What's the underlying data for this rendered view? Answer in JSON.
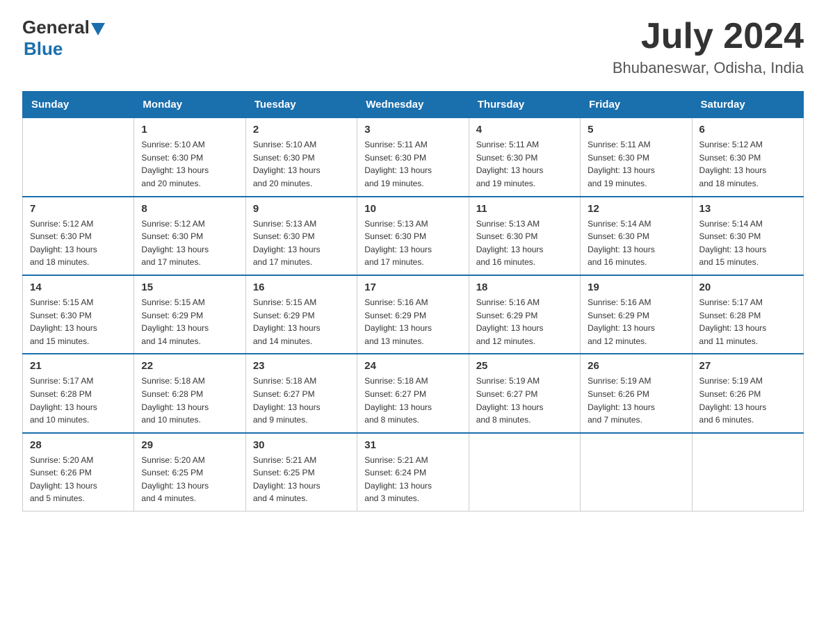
{
  "header": {
    "logo": {
      "general": "General",
      "blue": "Blue"
    },
    "title": "July 2024",
    "location": "Bhubaneswar, Odisha, India"
  },
  "calendar": {
    "days_of_week": [
      "Sunday",
      "Monday",
      "Tuesday",
      "Wednesday",
      "Thursday",
      "Friday",
      "Saturday"
    ],
    "weeks": [
      [
        {
          "day": "",
          "info": ""
        },
        {
          "day": "1",
          "info": "Sunrise: 5:10 AM\nSunset: 6:30 PM\nDaylight: 13 hours\nand 20 minutes."
        },
        {
          "day": "2",
          "info": "Sunrise: 5:10 AM\nSunset: 6:30 PM\nDaylight: 13 hours\nand 20 minutes."
        },
        {
          "day": "3",
          "info": "Sunrise: 5:11 AM\nSunset: 6:30 PM\nDaylight: 13 hours\nand 19 minutes."
        },
        {
          "day": "4",
          "info": "Sunrise: 5:11 AM\nSunset: 6:30 PM\nDaylight: 13 hours\nand 19 minutes."
        },
        {
          "day": "5",
          "info": "Sunrise: 5:11 AM\nSunset: 6:30 PM\nDaylight: 13 hours\nand 19 minutes."
        },
        {
          "day": "6",
          "info": "Sunrise: 5:12 AM\nSunset: 6:30 PM\nDaylight: 13 hours\nand 18 minutes."
        }
      ],
      [
        {
          "day": "7",
          "info": "Sunrise: 5:12 AM\nSunset: 6:30 PM\nDaylight: 13 hours\nand 18 minutes."
        },
        {
          "day": "8",
          "info": "Sunrise: 5:12 AM\nSunset: 6:30 PM\nDaylight: 13 hours\nand 17 minutes."
        },
        {
          "day": "9",
          "info": "Sunrise: 5:13 AM\nSunset: 6:30 PM\nDaylight: 13 hours\nand 17 minutes."
        },
        {
          "day": "10",
          "info": "Sunrise: 5:13 AM\nSunset: 6:30 PM\nDaylight: 13 hours\nand 17 minutes."
        },
        {
          "day": "11",
          "info": "Sunrise: 5:13 AM\nSunset: 6:30 PM\nDaylight: 13 hours\nand 16 minutes."
        },
        {
          "day": "12",
          "info": "Sunrise: 5:14 AM\nSunset: 6:30 PM\nDaylight: 13 hours\nand 16 minutes."
        },
        {
          "day": "13",
          "info": "Sunrise: 5:14 AM\nSunset: 6:30 PM\nDaylight: 13 hours\nand 15 minutes."
        }
      ],
      [
        {
          "day": "14",
          "info": "Sunrise: 5:15 AM\nSunset: 6:30 PM\nDaylight: 13 hours\nand 15 minutes."
        },
        {
          "day": "15",
          "info": "Sunrise: 5:15 AM\nSunset: 6:29 PM\nDaylight: 13 hours\nand 14 minutes."
        },
        {
          "day": "16",
          "info": "Sunrise: 5:15 AM\nSunset: 6:29 PM\nDaylight: 13 hours\nand 14 minutes."
        },
        {
          "day": "17",
          "info": "Sunrise: 5:16 AM\nSunset: 6:29 PM\nDaylight: 13 hours\nand 13 minutes."
        },
        {
          "day": "18",
          "info": "Sunrise: 5:16 AM\nSunset: 6:29 PM\nDaylight: 13 hours\nand 12 minutes."
        },
        {
          "day": "19",
          "info": "Sunrise: 5:16 AM\nSunset: 6:29 PM\nDaylight: 13 hours\nand 12 minutes."
        },
        {
          "day": "20",
          "info": "Sunrise: 5:17 AM\nSunset: 6:28 PM\nDaylight: 13 hours\nand 11 minutes."
        }
      ],
      [
        {
          "day": "21",
          "info": "Sunrise: 5:17 AM\nSunset: 6:28 PM\nDaylight: 13 hours\nand 10 minutes."
        },
        {
          "day": "22",
          "info": "Sunrise: 5:18 AM\nSunset: 6:28 PM\nDaylight: 13 hours\nand 10 minutes."
        },
        {
          "day": "23",
          "info": "Sunrise: 5:18 AM\nSunset: 6:27 PM\nDaylight: 13 hours\nand 9 minutes."
        },
        {
          "day": "24",
          "info": "Sunrise: 5:18 AM\nSunset: 6:27 PM\nDaylight: 13 hours\nand 8 minutes."
        },
        {
          "day": "25",
          "info": "Sunrise: 5:19 AM\nSunset: 6:27 PM\nDaylight: 13 hours\nand 8 minutes."
        },
        {
          "day": "26",
          "info": "Sunrise: 5:19 AM\nSunset: 6:26 PM\nDaylight: 13 hours\nand 7 minutes."
        },
        {
          "day": "27",
          "info": "Sunrise: 5:19 AM\nSunset: 6:26 PM\nDaylight: 13 hours\nand 6 minutes."
        }
      ],
      [
        {
          "day": "28",
          "info": "Sunrise: 5:20 AM\nSunset: 6:26 PM\nDaylight: 13 hours\nand 5 minutes."
        },
        {
          "day": "29",
          "info": "Sunrise: 5:20 AM\nSunset: 6:25 PM\nDaylight: 13 hours\nand 4 minutes."
        },
        {
          "day": "30",
          "info": "Sunrise: 5:21 AM\nSunset: 6:25 PM\nDaylight: 13 hours\nand 4 minutes."
        },
        {
          "day": "31",
          "info": "Sunrise: 5:21 AM\nSunset: 6:24 PM\nDaylight: 13 hours\nand 3 minutes."
        },
        {
          "day": "",
          "info": ""
        },
        {
          "day": "",
          "info": ""
        },
        {
          "day": "",
          "info": ""
        }
      ]
    ]
  }
}
